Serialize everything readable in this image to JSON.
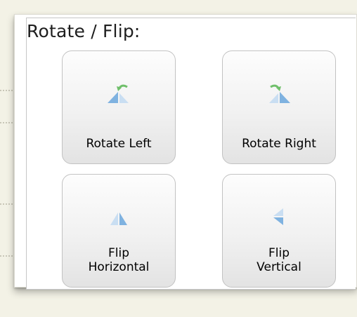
{
  "panel": {
    "title": "Rotate / Flip:"
  },
  "buttons": [
    {
      "label": "Rotate Left",
      "icon": "rotate-left-icon"
    },
    {
      "label": "Rotate Right",
      "icon": "rotate-right-icon"
    },
    {
      "label": "Flip\nHorizontal",
      "icon": "flip-horizontal-icon"
    },
    {
      "label": "Flip\nVertical",
      "icon": "flip-vertical-icon"
    }
  ],
  "colors": {
    "icon_blue": "#7fb2e0",
    "icon_blue_light": "#c9def2",
    "icon_green": "#6fbf6a",
    "page_background": "#f3f2e6"
  }
}
